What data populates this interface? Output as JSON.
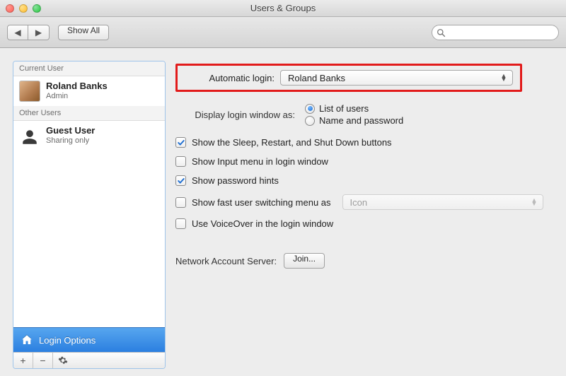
{
  "window": {
    "title": "Users & Groups"
  },
  "toolbar": {
    "showAll": "Show All",
    "searchPlaceholder": ""
  },
  "sidebar": {
    "currentHeader": "Current User",
    "currentUser": {
      "name": "Roland Banks",
      "role": "Admin"
    },
    "otherHeader": "Other Users",
    "otherUsers": [
      {
        "name": "Guest User",
        "role": "Sharing only"
      }
    ],
    "loginOptions": "Login Options"
  },
  "main": {
    "autoLoginLabel": "Automatic login:",
    "autoLoginValue": "Roland Banks",
    "displayLoginLabel": "Display login window as:",
    "radioList": "List of users",
    "radioNamePw": "Name and password",
    "checks": {
      "sleep": "Show the Sleep, Restart, and Shut Down buttons",
      "inputMenu": "Show Input menu in login window",
      "pwHints": "Show password hints",
      "fastSwitch": "Show fast user switching menu as",
      "fastSwitchValue": "Icon",
      "voiceOver": "Use VoiceOver in the login window"
    },
    "networkLabel": "Network Account Server:",
    "joinLabel": "Join..."
  }
}
